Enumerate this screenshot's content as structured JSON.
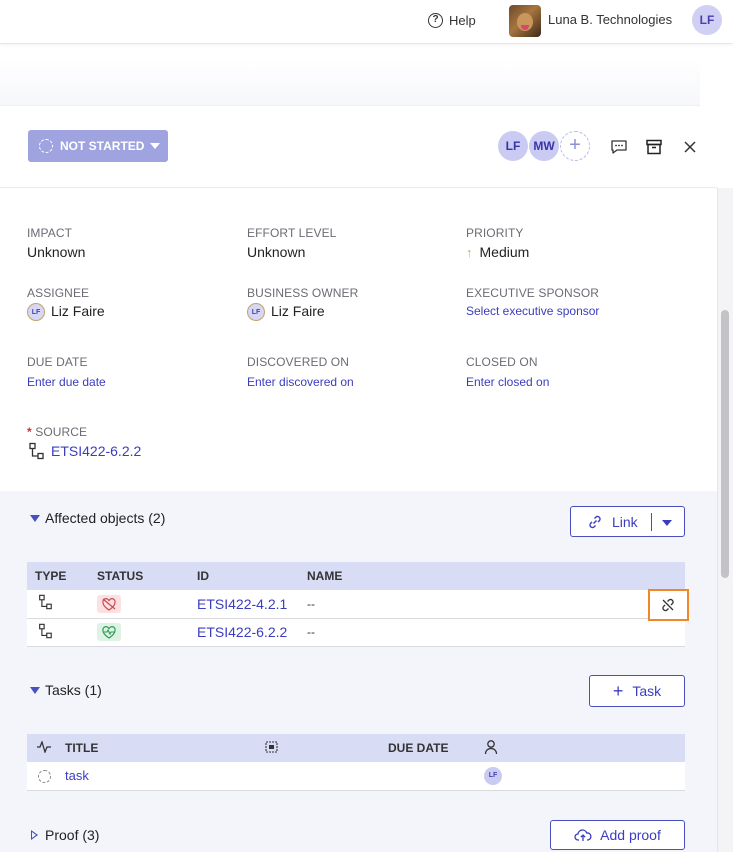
{
  "topbar": {
    "help_label": "Help",
    "company_name": "Luna B. Technologies",
    "user_initials": "LF"
  },
  "header": {
    "status_label": "NOT STARTED",
    "assignees": [
      "LF",
      "MW"
    ],
    "add_icon": "plus-icon",
    "comment_icon": "comment-icon",
    "archive_icon": "archive-icon",
    "close_icon": "close-icon"
  },
  "fields": {
    "impact": {
      "label": "IMPACT",
      "value": "Unknown"
    },
    "effort": {
      "label": "EFFORT LEVEL",
      "value": "Unknown"
    },
    "priority": {
      "label": "PRIORITY",
      "value": "Medium",
      "color": "#f0a334"
    },
    "assignee": {
      "label": "ASSIGNEE",
      "value": "Liz Faire",
      "initials": "LF"
    },
    "business_owner": {
      "label": "BUSINESS OWNER",
      "value": "Liz Faire",
      "initials": "LF"
    },
    "exec_sponsor": {
      "label": "EXECUTIVE SPONSOR",
      "placeholder": "Select executive sponsor"
    },
    "due_date": {
      "label": "DUE DATE",
      "placeholder": "Enter due date"
    },
    "discovered_on": {
      "label": "DISCOVERED ON",
      "placeholder": "Enter discovered on"
    },
    "closed_on": {
      "label": "CLOSED ON",
      "placeholder": "Enter closed on"
    },
    "source": {
      "required_mark": "*",
      "label": "SOURCE",
      "value": "ETSI422-6.2.2"
    }
  },
  "affected": {
    "title": "Affected objects (2)",
    "link_label": "Link",
    "columns": [
      "TYPE",
      "STATUS",
      "ID",
      "NAME"
    ],
    "rows": [
      {
        "status": "broken-heart-icon",
        "id": "ETSI422-4.2.1",
        "name": "--"
      },
      {
        "status": "heartbeat-icon",
        "id": "ETSI422-6.2.2",
        "name": "--"
      }
    ]
  },
  "tasks": {
    "title": "Tasks (1)",
    "add_label": "Task",
    "columns": {
      "title": "TITLE",
      "due": "DUE DATE"
    },
    "rows": [
      {
        "title": "task",
        "assignee": "LF"
      }
    ]
  },
  "proof": {
    "title": "Proof (3)",
    "add_label": "Add proof"
  },
  "colors": {
    "accent": "#4a4fc0",
    "status_button": "#9fa3e0",
    "highlight": "#f0872b"
  }
}
